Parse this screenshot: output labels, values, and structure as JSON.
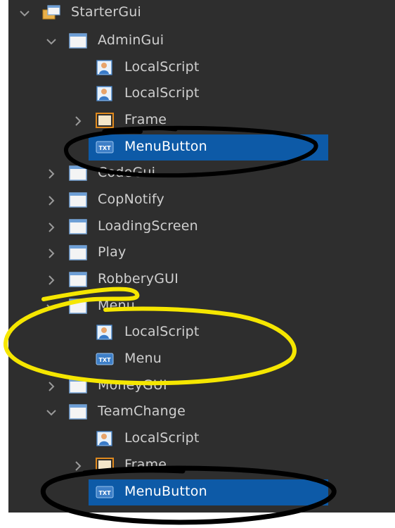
{
  "explorer": {
    "rows": [
      {
        "label": "StarterGui",
        "icon": "startergui-icon",
        "expander": "expanded"
      },
      {
        "label": "AdminGui",
        "icon": "screengui-icon",
        "expander": "expanded"
      },
      {
        "label": "LocalScript",
        "icon": "localscript-icon",
        "expander": "none"
      },
      {
        "label": "LocalScript",
        "icon": "localscript-icon",
        "expander": "none"
      },
      {
        "label": "Frame",
        "icon": "frame-icon",
        "expander": "collapsed"
      },
      {
        "label": "MenuButton",
        "icon": "textbutton-icon",
        "expander": "none",
        "selected": true
      },
      {
        "label": "CodeGui",
        "icon": "screengui-icon",
        "expander": "collapsed"
      },
      {
        "label": "CopNotify",
        "icon": "screengui-icon",
        "expander": "collapsed"
      },
      {
        "label": "LoadingScreen",
        "icon": "screengui-icon",
        "expander": "collapsed"
      },
      {
        "label": "Play",
        "icon": "screengui-icon",
        "expander": "collapsed"
      },
      {
        "label": "RobberyGUI",
        "icon": "screengui-icon",
        "expander": "collapsed"
      },
      {
        "label": "Menu",
        "icon": "screengui-icon",
        "expander": "expanded"
      },
      {
        "label": "LocalScript",
        "icon": "localscript-icon",
        "expander": "none"
      },
      {
        "label": "Menu",
        "icon": "textbutton-icon",
        "expander": "none"
      },
      {
        "label": "MoneyGUI",
        "icon": "screengui-icon",
        "expander": "collapsed"
      },
      {
        "label": "TeamChange",
        "icon": "screengui-icon",
        "expander": "expanded"
      },
      {
        "label": "LocalScript",
        "icon": "localscript-icon",
        "expander": "none"
      },
      {
        "label": "Frame",
        "icon": "frame-icon",
        "expander": "collapsed"
      },
      {
        "label": "MenuButton",
        "icon": "textbutton-icon",
        "expander": "none",
        "selected": true
      }
    ]
  },
  "colors": {
    "panel_background": "#2e2e2e",
    "text": "#cfcfcf",
    "selection": "#0d5aa7",
    "annotation_black": "#000000",
    "annotation_yellow": "#f5e600"
  },
  "annotations": [
    {
      "kind": "hand-drawn-circle",
      "color": "black",
      "around": "MenuButton (AdminGui)"
    },
    {
      "kind": "hand-drawn-circle",
      "color": "yellow",
      "around": "Menu"
    },
    {
      "kind": "hand-drawn-circle",
      "color": "black",
      "around": "MenuButton (TeamChange)"
    }
  ]
}
